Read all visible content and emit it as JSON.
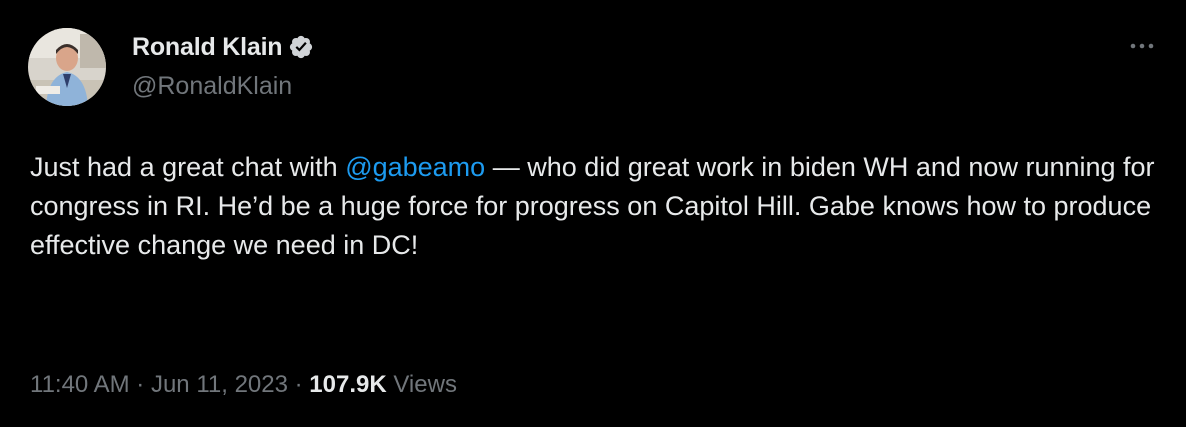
{
  "author": {
    "display_name": "Ronald Klain",
    "handle": "@RonaldKlain",
    "verified": true,
    "avatar_icon": "profile-photo"
  },
  "tweet": {
    "text_before": "Just had a great chat with ",
    "mention": "@gabeamo",
    "text_after": "  — who did great work in biden WH and now running for congress in RI.  He’d be a huge force for progress on Capitol Hill.  Gabe knows how to produce effective change we need in DC!"
  },
  "meta": {
    "time": "11:40 AM",
    "separator": " · ",
    "date": "Jun 11, 2023",
    "views_count": "107.9K",
    "views_label": " Views"
  },
  "colors": {
    "background": "#000000",
    "text": "#e7e9ea",
    "secondary": "#71767b",
    "accent": "#1d9bf0"
  },
  "icons": {
    "more": "more-horizontal-icon",
    "verified": "verified-badge-icon"
  }
}
